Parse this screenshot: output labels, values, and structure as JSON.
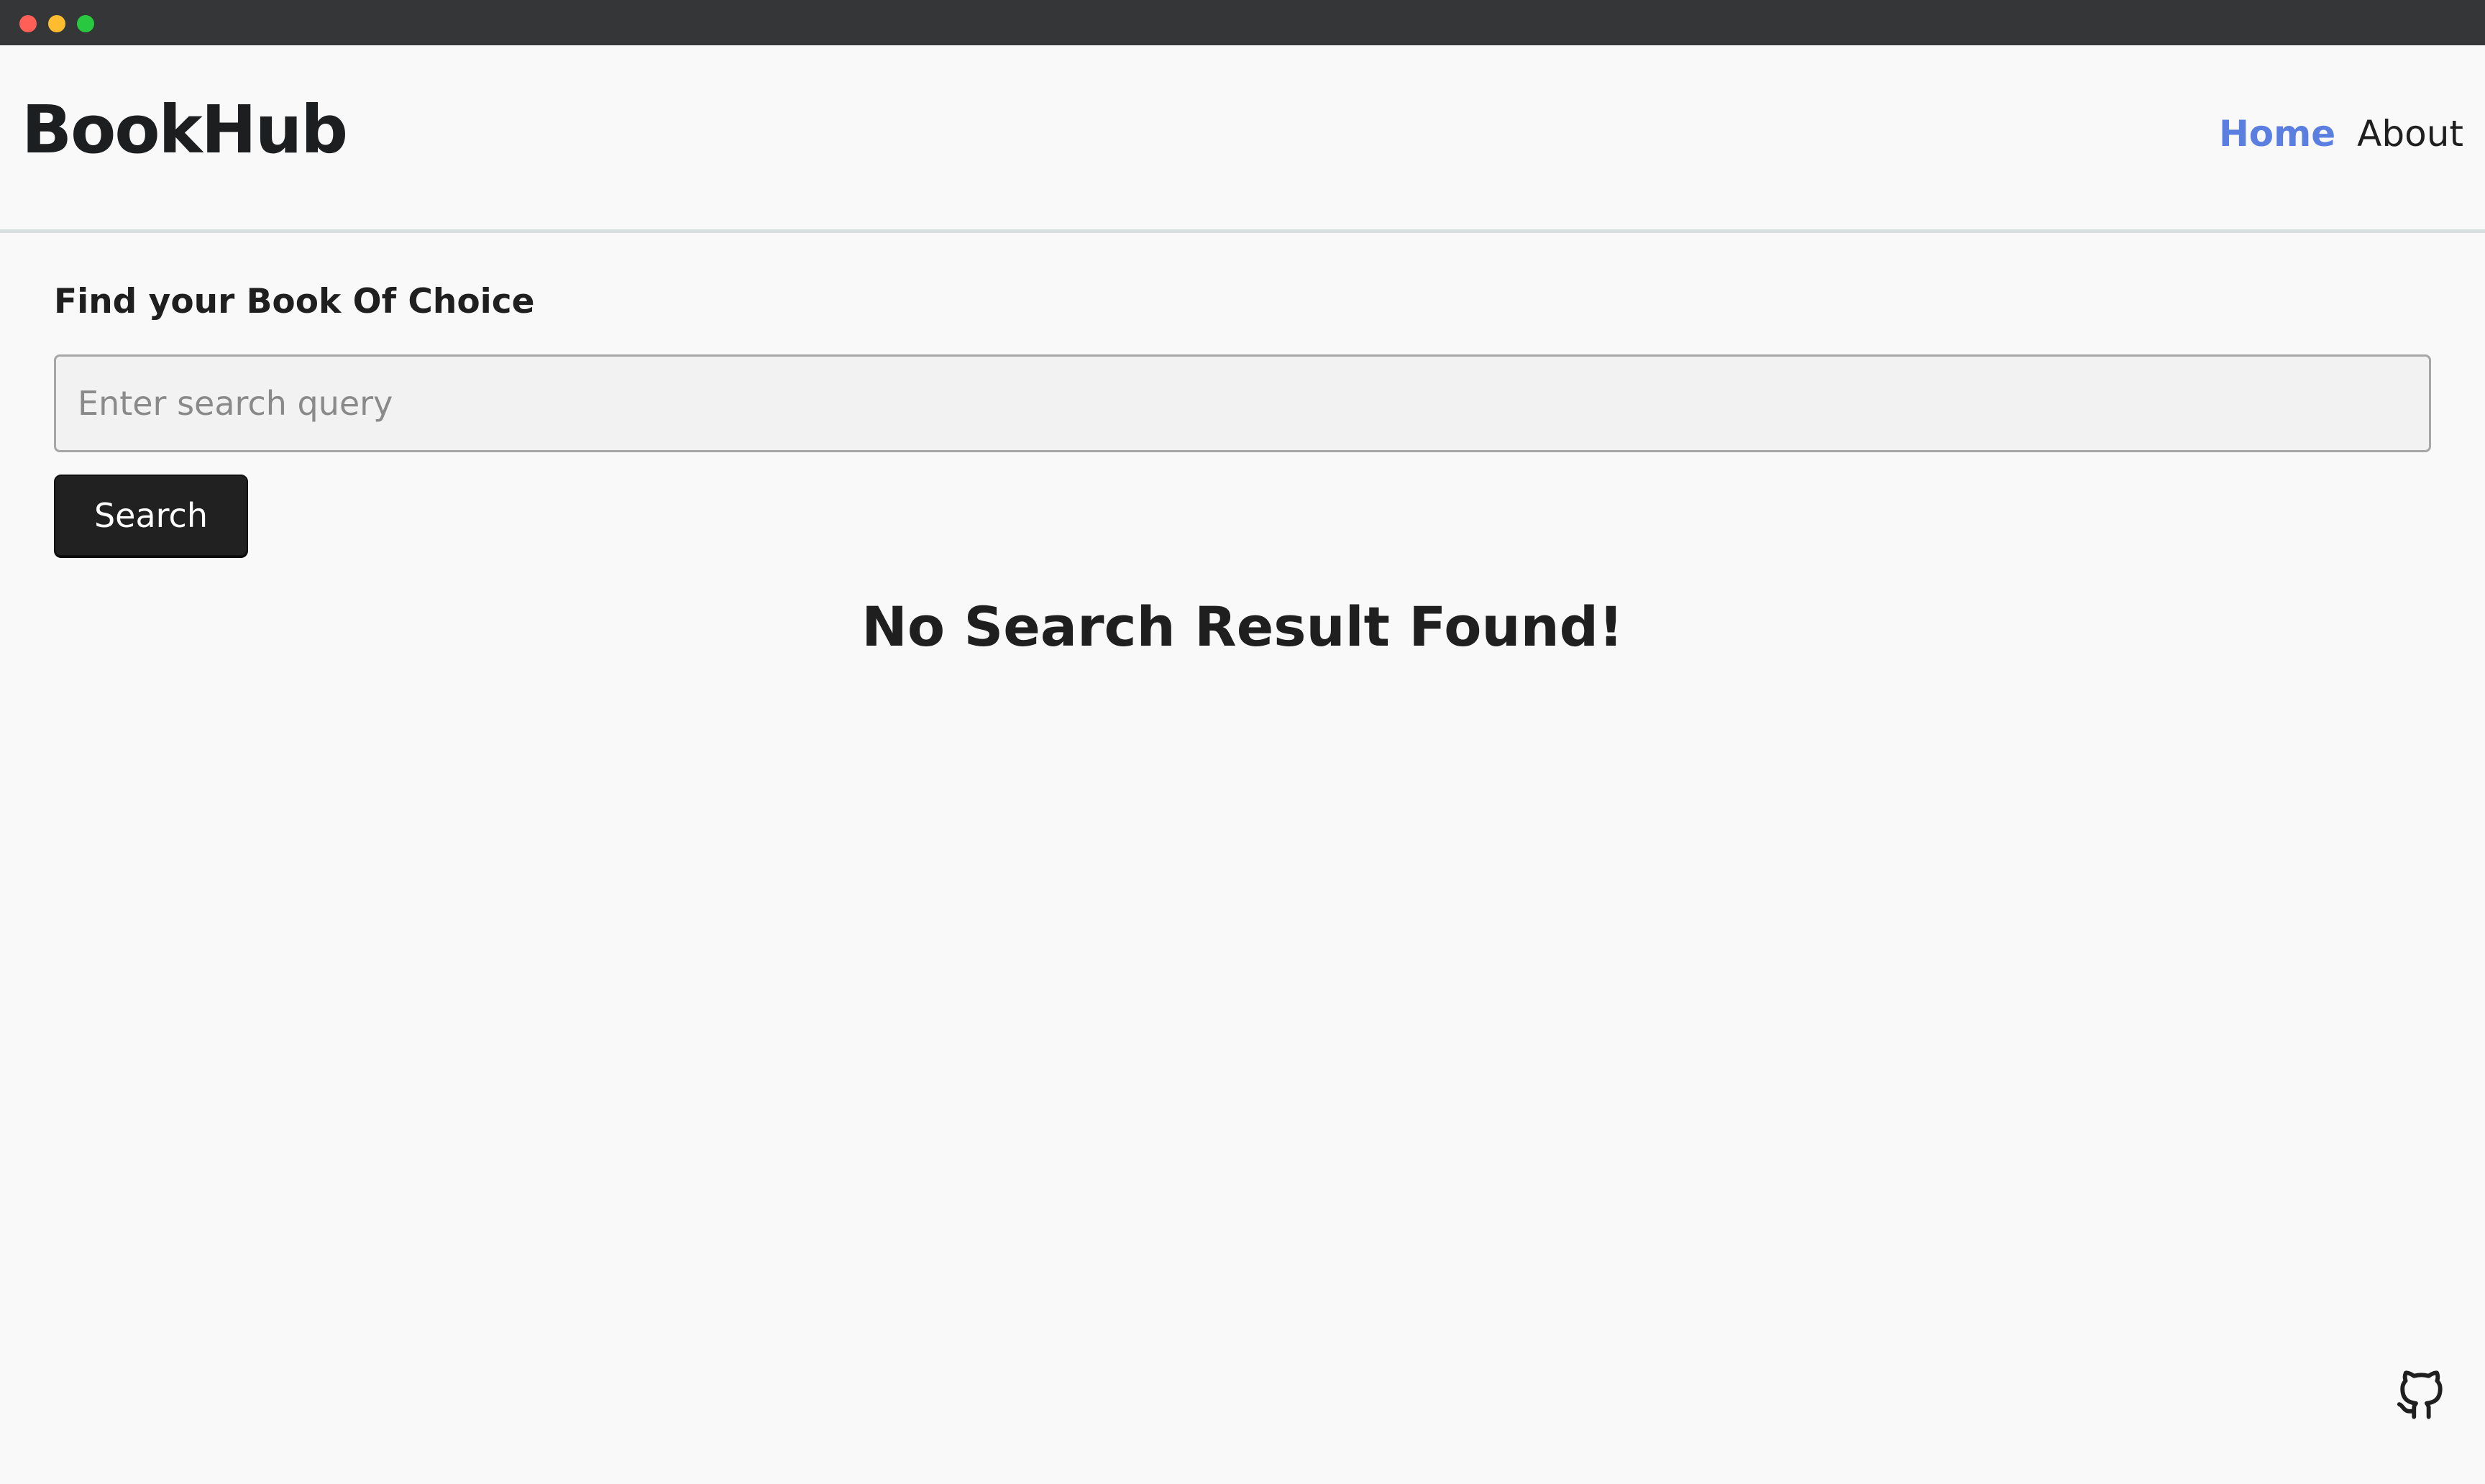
{
  "window": {
    "controls": [
      "close",
      "minimize",
      "maximize"
    ]
  },
  "colors": {
    "accent": "#5a7fe0",
    "control_red": "#ff5f57",
    "control_yellow": "#febc2e",
    "control_green": "#28c840"
  },
  "header": {
    "brand": "BookHub",
    "nav": [
      {
        "label": "Home",
        "active": true
      },
      {
        "label": "About",
        "active": false
      }
    ]
  },
  "search": {
    "heading": "Find your Book Of Choice",
    "placeholder": "Enter search query",
    "value": "",
    "button_label": "Search"
  },
  "results": {
    "empty_message": "No Search Result Found!"
  },
  "footer": {
    "icon": "github-icon"
  }
}
